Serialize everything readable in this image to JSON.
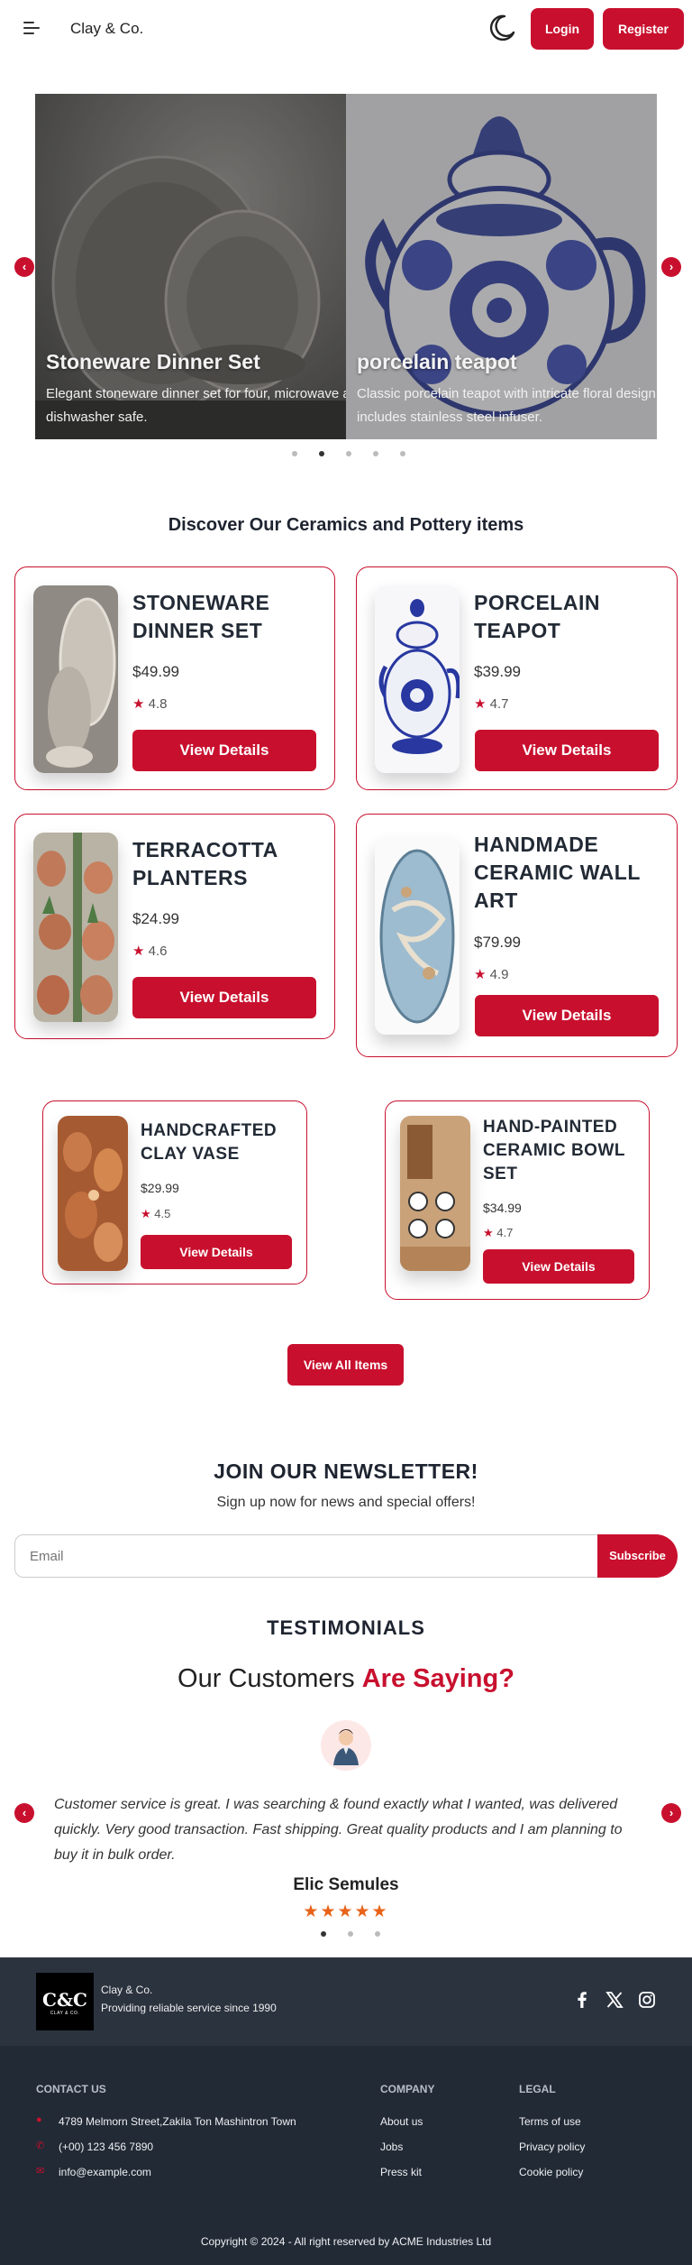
{
  "header": {
    "brand": "Clay & Co.",
    "login_label": "Login",
    "register_label": "Register"
  },
  "carousel": {
    "slides": [
      {
        "title": "Stoneware Dinner Set",
        "description": "Elegant stoneware dinner set for four, microwave and dishwasher safe."
      },
      {
        "title": "porcelain teapot",
        "description": "Classic porcelain teapot with intricate floral design, includes stainless steel infuser."
      }
    ],
    "dot_count": 5,
    "active_dot": 1
  },
  "products": {
    "section_title": "Discover Our Ceramics and Pottery items",
    "view_details_label": "View Details",
    "items": [
      {
        "name": "STONEWARE DINNER SET",
        "price": "$49.99",
        "rating": "4.8"
      },
      {
        "name": "PORCELAIN TEAPOT",
        "price": "$39.99",
        "rating": "4.7"
      },
      {
        "name": "TERRACOTTA PLANTERS",
        "price": "$24.99",
        "rating": "4.6"
      },
      {
        "name": "HANDMADE CERAMIC WALL ART",
        "price": "$79.99",
        "rating": "4.9"
      },
      {
        "name": "HANDCRAFTED CLAY VASE",
        "price": "$29.99",
        "rating": "4.5"
      },
      {
        "name": "HAND-PAINTED CERAMIC BOWL SET",
        "price": "$34.99",
        "rating": "4.7"
      }
    ],
    "view_all_label": "View All Items"
  },
  "newsletter": {
    "title": "JOIN OUR NEWSLETTER!",
    "subtitle": "Sign up now for news and special offers!",
    "email_placeholder": "Email",
    "subscribe_label": "Subscribe"
  },
  "testimonials": {
    "title": "TESTIMONIALS",
    "subtitle_plain": "Our Customers",
    "subtitle_accent": "Are Saying?",
    "quote": "Customer service is great. I was searching & found exactly what I wanted, was delivered quickly. Very good transaction. Fast shipping. Great quality products and I am planning to buy it in bulk order.",
    "author": "Elic Semules",
    "stars": "★★★★★",
    "dot_count": 3,
    "active_dot": 0
  },
  "footer": {
    "logo_text": "C&C",
    "logo_subtext": "CLAY & CO.",
    "brand": "Clay & Co.",
    "tagline": "Providing reliable service since 1990",
    "contact": {
      "heading": "CONTACT US",
      "address": "4789 Melmorn Street,Zakila Ton Mashintron Town",
      "phone": "(+00) 123 456 7890",
      "email": "info@example.com"
    },
    "company": {
      "heading": "COMPANY",
      "links": [
        "About us",
        "Jobs",
        "Press kit"
      ]
    },
    "legal": {
      "heading": "LEGAL",
      "links": [
        "Terms of use",
        "Privacy policy",
        "Cookie policy"
      ]
    },
    "copyright": "Copyright © 2024 - All right reserved by ACME Industries Ltd"
  },
  "colors": {
    "accent": "#c8102e",
    "footer_top": "#2b333f",
    "footer_main": "#222a35",
    "star_orange": "#e8631a"
  },
  "icons": [
    "menu-icon",
    "moon-icon",
    "chevron-left-icon",
    "chevron-right-icon",
    "star-icon",
    "map-pin-icon",
    "phone-icon",
    "mail-icon",
    "facebook-icon",
    "x-icon",
    "instagram-icon"
  ]
}
